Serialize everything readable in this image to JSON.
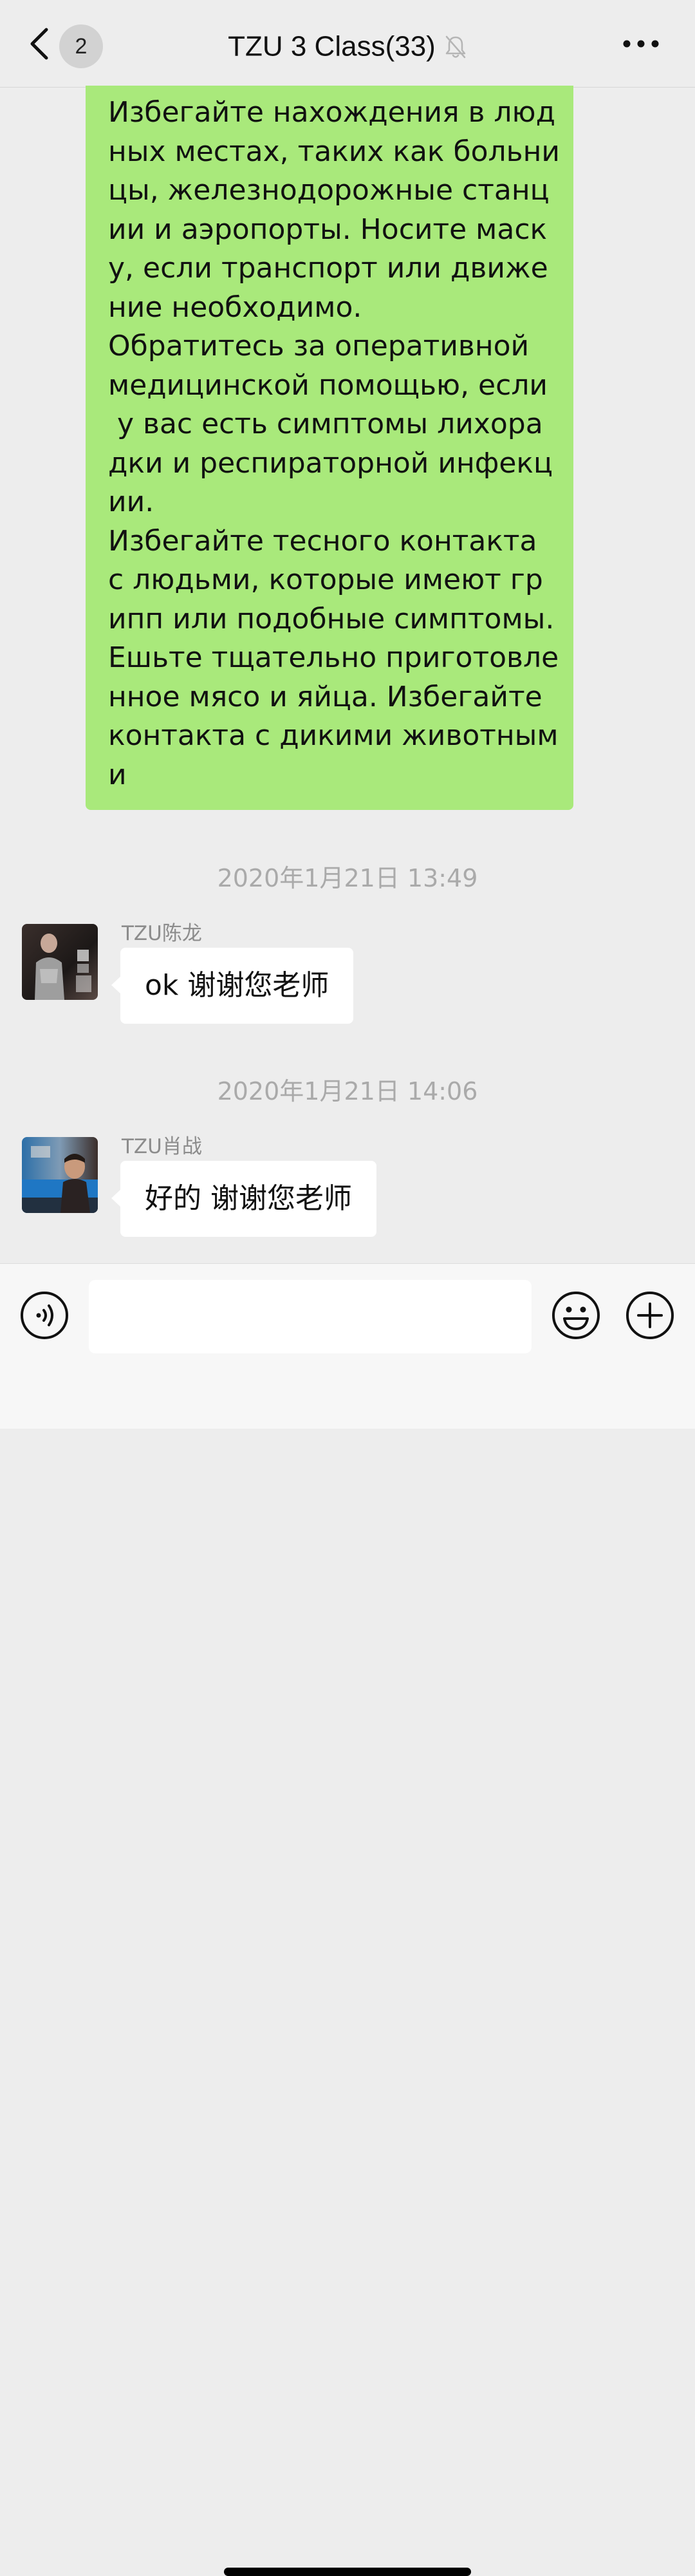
{
  "header": {
    "back_icon": "chevron-left-icon",
    "unread_count": "2",
    "title": "TZU 3 Class(33)",
    "mute_icon": "bell-muted-icon",
    "more_icon": "more-dots-icon"
  },
  "messages": {
    "outgoing": {
      "lines": [
        "Избегайте нахождения в люд",
        "ных местах, таких как больни",
        "цы, железнодорожные станц",
        "ии и аэропорты. Носите маск",
        "у, если транспорт или движе",
        "ние необходимо.",
        "Обратитесь за оперативной",
        "медицинской помощью, если",
        " у вас есть симптомы лихора",
        "дки и респираторной инфекц",
        "ии.",
        "Избегайте тесного контакта",
        "с людьми, которые имеют гр",
        "ипп или подобные симптомы.",
        "Ешьте тщательно приготовле",
        "нное мясо и яйца. Избегайте",
        "контакта с дикими животным",
        "и"
      ],
      "bubble_color": "#a9e97b"
    },
    "timestamp_1": "2020年1月21日 13:49",
    "message_1": {
      "sender": "TZU陈龙",
      "text": "ok 谢谢您老师"
    },
    "timestamp_2": "2020年1月21日 14:06",
    "message_2": {
      "sender": "TZU肖战",
      "text": "好的 谢谢您老师"
    }
  },
  "input_bar": {
    "voice_icon": "voice-input-icon",
    "input_value": "",
    "emoji_icon": "emoji-icon",
    "plus_icon": "plus-circle-icon"
  }
}
